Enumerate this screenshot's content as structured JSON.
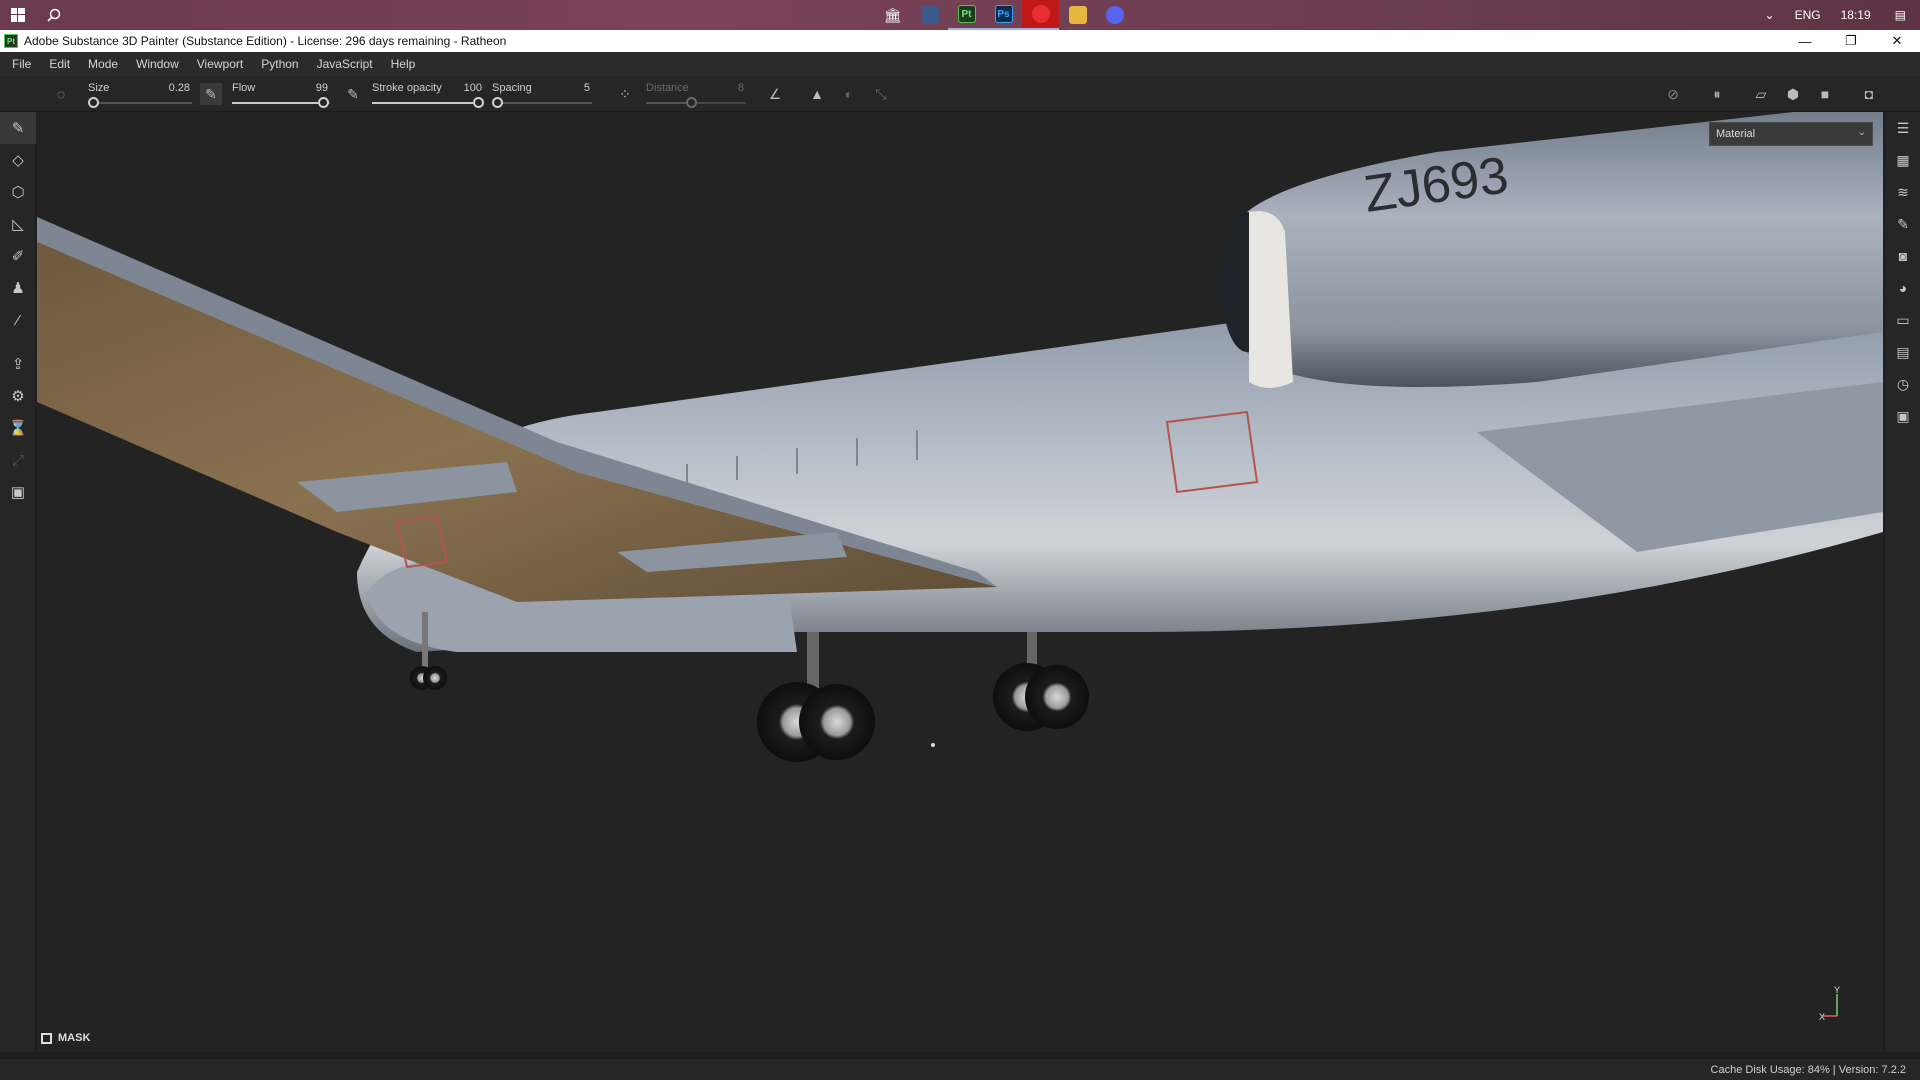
{
  "taskbar": {
    "apps": [
      {
        "name": "library-app",
        "label": "",
        "color": "#8a6a50"
      },
      {
        "name": "steam-app",
        "label": "",
        "color": "#3b5a8a"
      },
      {
        "name": "painter-app",
        "label": "Pt",
        "color": "#1f3a1f"
      },
      {
        "name": "photoshop-app",
        "label": "Ps",
        "color": "#0d2a4a"
      },
      {
        "name": "record-app",
        "label": "",
        "color": "#d62020"
      },
      {
        "name": "explorer-app",
        "label": "",
        "color": "#e7b740"
      },
      {
        "name": "discord-app",
        "label": "",
        "color": "#5865f2"
      }
    ],
    "language": "ENG",
    "time": "18:19"
  },
  "window": {
    "title": "Adobe Substance 3D Painter (Substance Edition) - License: 296 days remaining - Ratheon"
  },
  "menu": [
    "File",
    "Edit",
    "Mode",
    "Window",
    "Viewport",
    "Python",
    "JavaScript",
    "Help"
  ],
  "toolbar": {
    "size": {
      "label": "Size",
      "value": "0.28",
      "fraction": 0.0
    },
    "flow": {
      "label": "Flow",
      "value": "99",
      "fraction": 0.99
    },
    "stroke_opacity": {
      "label": "Stroke opacity",
      "value": "100",
      "fraction": 1.0
    },
    "spacing": {
      "label": "Spacing",
      "value": "5",
      "fraction": 0.0
    },
    "distance": {
      "label": "Distance",
      "value": "8",
      "fraction": 0.45
    }
  },
  "viewport": {
    "material_mode": "Material",
    "mask_label": "MASK",
    "aircraft_tail_code": "ZJ693",
    "axis_y": "Y",
    "axis_x": "X"
  },
  "status": {
    "cache": "Cache Disk Usage:   84% | Version: 7.2.2"
  },
  "colors": {
    "background": "#222222",
    "panel": "#262626",
    "accent_green": "#52c552"
  }
}
